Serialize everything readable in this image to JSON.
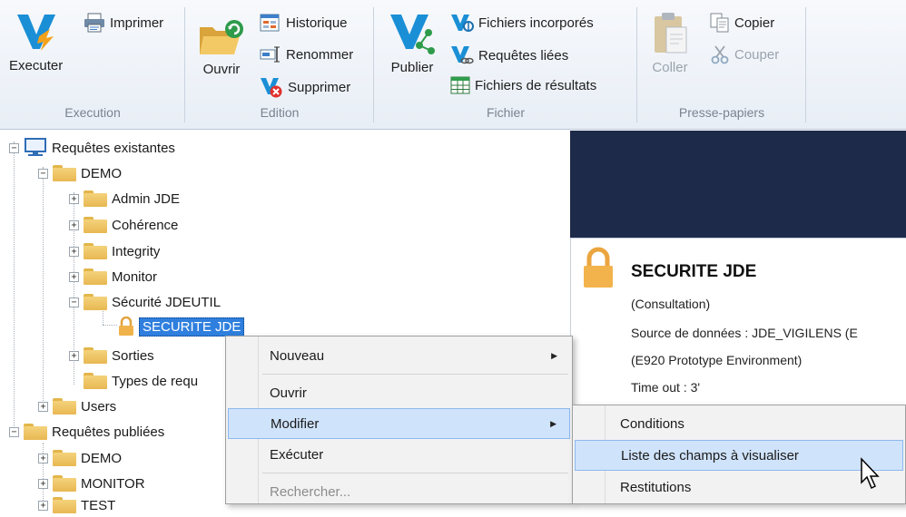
{
  "ribbon": {
    "execution": {
      "label": "Execution",
      "executer": "Executer",
      "imprimer": "Imprimer"
    },
    "edition": {
      "label": "Edition",
      "ouvrir": "Ouvrir",
      "historique": "Historique",
      "renommer": "Renommer",
      "supprimer": "Supprimer"
    },
    "fichier": {
      "label": "Fichier",
      "publier": "Publier",
      "fichiers_incorpores": "Fichiers incorporés",
      "requetes_liees": "Requêtes liées",
      "fichiers_resultats": "Fichiers de résultats"
    },
    "presse_papiers": {
      "label": "Presse-papiers",
      "coller": "Coller",
      "copier": "Copier",
      "couper": "Couper"
    }
  },
  "tree": {
    "root_existing": "Requêtes existantes",
    "demo": "DEMO",
    "admin_jde": "Admin JDE",
    "coherence": "Cohérence",
    "integrity": "Integrity",
    "monitor": "Monitor",
    "securite_jdeutil": "Sécurité JDEUTIL",
    "securite_jde": "SECURITE JDE",
    "sorties": "Sorties",
    "types": "Types de requ",
    "users": "Users",
    "root_published": "Requêtes publiées",
    "pub_demo": "DEMO",
    "pub_monitor": "MONITOR",
    "pub_test": "TEST"
  },
  "info": {
    "title": "SECURITE JDE",
    "mode": "(Consultation)",
    "source": "Source de données : JDE_VIGILENS   (E",
    "environment": "(E920 Prototype Environment)",
    "timeout": "Time out : 3'"
  },
  "context_menu": {
    "nouveau": "Nouveau",
    "ouvrir": "Ouvrir",
    "modifier": "Modifier",
    "executer": "Exécuter",
    "rechercher": "Rechercher..."
  },
  "submenu": {
    "conditions": "Conditions",
    "liste_champs": "Liste des champs à visualiser",
    "restitutions": "Restitutions"
  },
  "colors": {
    "accent": "#2f7fde",
    "dark_panel": "#1d2a4a",
    "folder": "#f0c865",
    "menu_highlight": "#cfe3fb"
  }
}
